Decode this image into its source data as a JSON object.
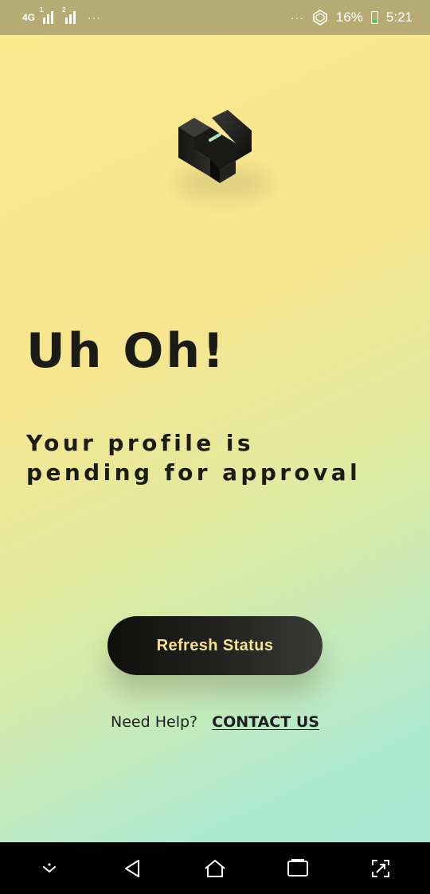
{
  "status_bar": {
    "network_type": "4G",
    "sim1_badge": "1",
    "sim2_badge": "2",
    "left_more": "···",
    "right_more": "···",
    "battery": "16%",
    "time": "5:21",
    "battery_fill_fraction": 0.16,
    "charging_color": "#35d04a"
  },
  "logo": {
    "icon": "app-logo-icon"
  },
  "main": {
    "title": "Uh Oh!",
    "subtitle_line1": "Your profile is",
    "subtitle_line2": "pending for approval"
  },
  "actions": {
    "refresh_label": "Refresh Status",
    "help_text": "Need Help?",
    "contact_label": "CONTACT US"
  },
  "nav_bar": {
    "buttons": [
      "chevron-down-icon",
      "back-icon",
      "home-icon",
      "recents-icon",
      "screenshot-icon"
    ]
  },
  "colors": {
    "accent_text": "#f6e38f",
    "dark": "#1c1c17",
    "gradient_start": "#fae98f",
    "gradient_end": "#a7e9d6"
  }
}
